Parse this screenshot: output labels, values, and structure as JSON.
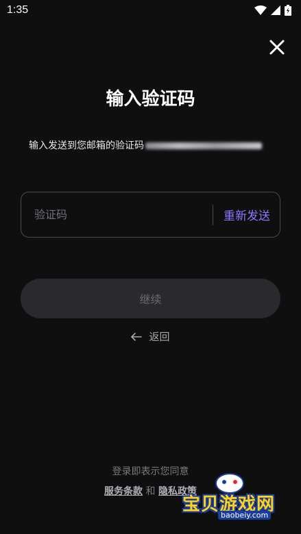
{
  "status_bar": {
    "time": "1:35"
  },
  "page": {
    "title": "输入验证码",
    "description": "输入发送到您邮箱的验证码"
  },
  "code_field": {
    "placeholder": "验证码",
    "resend_label": "重新发送"
  },
  "continue_label": "继续",
  "back_label": "返回",
  "footer": {
    "agree_text": "登录即表示您同意",
    "terms_label": "服务条款",
    "and_text": "和",
    "privacy_label": "隐私政策"
  },
  "watermark": {
    "brand": "宝贝游戏网",
    "url": "baobeiy.com"
  },
  "colors": {
    "background": "#0f0f10",
    "accent": "#8b78ff",
    "button_bg": "#2a2a2e"
  }
}
